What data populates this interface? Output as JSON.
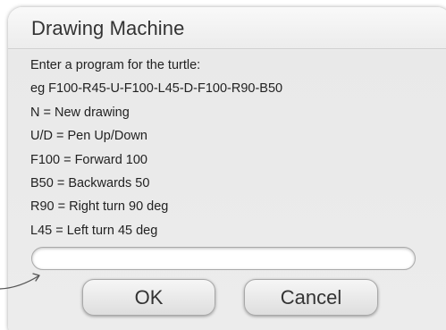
{
  "dialog": {
    "title": "Drawing Machine",
    "lines": [
      "Enter a program for the turtle:",
      "eg F100-R45-U-F100-L45-D-F100-R90-B50",
      "N = New drawing",
      "U/D = Pen Up/Down",
      "F100 = Forward 100",
      "B50 = Backwards 50",
      "R90 = Right turn 90 deg",
      "L45 = Left turn 45 deg"
    ],
    "input_value": "",
    "ok_label": "OK",
    "cancel_label": "Cancel"
  },
  "annotation": {
    "pointer_icon": "arrow-pointer-icon"
  }
}
